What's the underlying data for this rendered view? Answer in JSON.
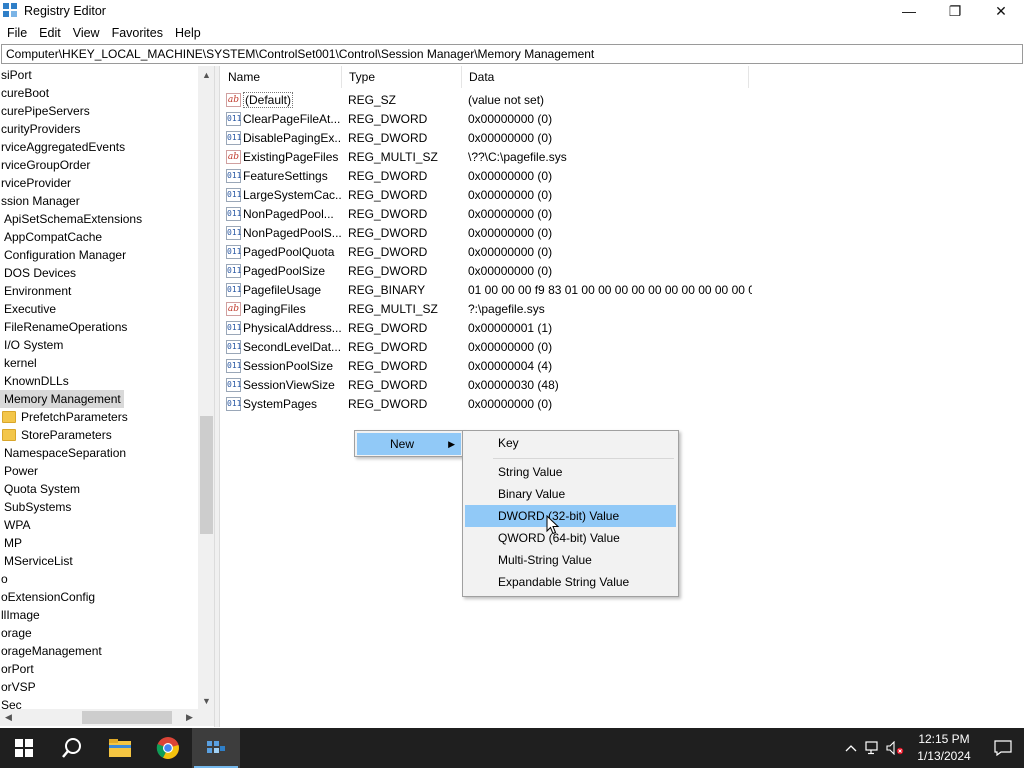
{
  "window": {
    "title": "Registry Editor",
    "controls": {
      "minimize": "—",
      "maximize": "❐",
      "close": "✕"
    }
  },
  "menubar": {
    "items": [
      "File",
      "Edit",
      "View",
      "Favorites",
      "Help"
    ]
  },
  "address": {
    "path": "Computer\\HKEY_LOCAL_MACHINE\\SYSTEM\\ControlSet001\\Control\\Session Manager\\Memory Management"
  },
  "tree": {
    "items": [
      "siPort",
      "cureBoot",
      "curePipeServers",
      "curityProviders",
      "rviceAggregatedEvents",
      "rviceGroupOrder",
      "rviceProvider",
      "ssion Manager",
      "ApiSetSchemaExtensions",
      "AppCompatCache",
      "Configuration Manager",
      "DOS Devices",
      "Environment",
      "Executive",
      "FileRenameOperations",
      "I/O System",
      "kernel",
      "KnownDLLs",
      "Memory Management",
      "PrefetchParameters",
      "StoreParameters",
      "NamespaceSeparation",
      "Power",
      "Quota System",
      "SubSystems",
      "WPA",
      "MP",
      "MServiceList",
      "o",
      "oExtensionConfig",
      "llImage",
      "orage",
      "orageManagement",
      "orPort",
      "orVSP",
      "Sec"
    ],
    "selected_index": 18
  },
  "list": {
    "columns": {
      "name": "Name",
      "type": "Type",
      "data": "Data"
    },
    "rows": [
      {
        "name": "(Default)",
        "type": "REG_SZ",
        "data": "(value not set)",
        "icon": "string-value-icon"
      },
      {
        "name": "ClearPageFileAt...",
        "type": "REG_DWORD",
        "data": "0x00000000 (0)",
        "icon": "binary-value-icon"
      },
      {
        "name": "DisablePagingEx...",
        "type": "REG_DWORD",
        "data": "0x00000000 (0)",
        "icon": "binary-value-icon"
      },
      {
        "name": "ExistingPageFiles",
        "type": "REG_MULTI_SZ",
        "data": "\\??\\C:\\pagefile.sys",
        "icon": "string-value-icon"
      },
      {
        "name": "FeatureSettings",
        "type": "REG_DWORD",
        "data": "0x00000000 (0)",
        "icon": "binary-value-icon"
      },
      {
        "name": "LargeSystemCac...",
        "type": "REG_DWORD",
        "data": "0x00000000 (0)",
        "icon": "binary-value-icon"
      },
      {
        "name": "NonPagedPool...",
        "type": "REG_DWORD",
        "data": "0x00000000 (0)",
        "icon": "binary-value-icon"
      },
      {
        "name": "NonPagedPoolS...",
        "type": "REG_DWORD",
        "data": "0x00000000 (0)",
        "icon": "binary-value-icon"
      },
      {
        "name": "PagedPoolQuota",
        "type": "REG_DWORD",
        "data": "0x00000000 (0)",
        "icon": "binary-value-icon"
      },
      {
        "name": "PagedPoolSize",
        "type": "REG_DWORD",
        "data": "0x00000000 (0)",
        "icon": "binary-value-icon"
      },
      {
        "name": "PagefileUsage",
        "type": "REG_BINARY",
        "data": "01 00 00 00 f9 83 01 00 00 00 00 00 00 00 00 00 00 00 00...",
        "icon": "binary-value-icon"
      },
      {
        "name": "PagingFiles",
        "type": "REG_MULTI_SZ",
        "data": "?:\\pagefile.sys",
        "icon": "string-value-icon"
      },
      {
        "name": "PhysicalAddress...",
        "type": "REG_DWORD",
        "data": "0x00000001 (1)",
        "icon": "binary-value-icon"
      },
      {
        "name": "SecondLevelDat...",
        "type": "REG_DWORD",
        "data": "0x00000000 (0)",
        "icon": "binary-value-icon"
      },
      {
        "name": "SessionPoolSize",
        "type": "REG_DWORD",
        "data": "0x00000004 (4)",
        "icon": "binary-value-icon"
      },
      {
        "name": "SessionViewSize",
        "type": "REG_DWORD",
        "data": "0x00000030 (48)",
        "icon": "binary-value-icon"
      },
      {
        "name": "SystemPages",
        "type": "REG_DWORD",
        "data": "0x00000000 (0)",
        "icon": "binary-value-icon"
      }
    ]
  },
  "context_menu": {
    "new_label": "New",
    "submenu": {
      "key": "Key",
      "string": "String Value",
      "binary": "Binary Value",
      "dword": "DWORD (32-bit) Value",
      "qword": "QWORD (64-bit) Value",
      "multi": "Multi-String Value",
      "expandable": "Expandable String Value"
    },
    "highlighted_item": "dword"
  },
  "taskbar": {
    "apps": [
      "start-icon",
      "search-icon",
      "file-explorer-icon",
      "chrome-icon",
      "regedit-icon"
    ],
    "active_app": "regedit-icon",
    "clock_time": "12:15 PM",
    "clock_date": "1/13/2024"
  },
  "colors": {
    "highlight": "#91c9f7",
    "selected_tree": "#d9d9d9",
    "taskbar": "#1f1f1f",
    "accent": "#76b9ed"
  }
}
